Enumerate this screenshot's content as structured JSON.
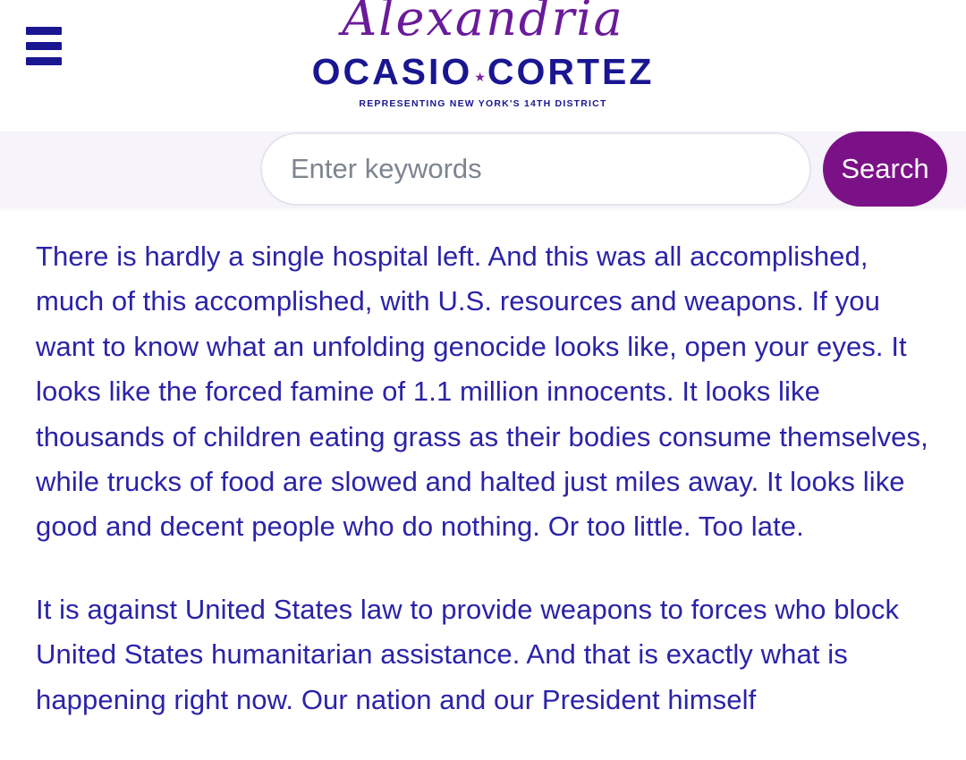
{
  "header": {
    "logo": {
      "script_name": "Alexandria",
      "name_left": "OCASIO",
      "star": "★",
      "name_right": "CORTEZ",
      "tagline": "REPRESENTING NEW YORK'S 14TH DISTRICT"
    },
    "menu_icon": "hamburger-menu-icon"
  },
  "search": {
    "placeholder": "Enter keywords",
    "value": "",
    "button_label": "Search"
  },
  "content": {
    "paragraphs": [
      "There is hardly a single hospital left. And this was all accomplished, much of this accomplished, with U.S. resources and weapons. If you want to know what an unfolding genocide looks like, open your eyes. It looks like the forced famine of 1.1 million innocents. It looks like thousands of children eating grass as their bodies consume themselves, while trucks of food are slowed and halted just miles away. It looks like good and decent people who do nothing. Or too little. Too late.",
      "It is against United States law to provide weapons to forces who block United States humanitarian assistance. And that is exactly what is happening right now. Our nation and our President himself"
    ]
  },
  "colors": {
    "brand_navy": "#1a1691",
    "brand_purple": "#7b1187",
    "text": "#2b23a8",
    "search_band_bg": "#f6f3fa"
  }
}
